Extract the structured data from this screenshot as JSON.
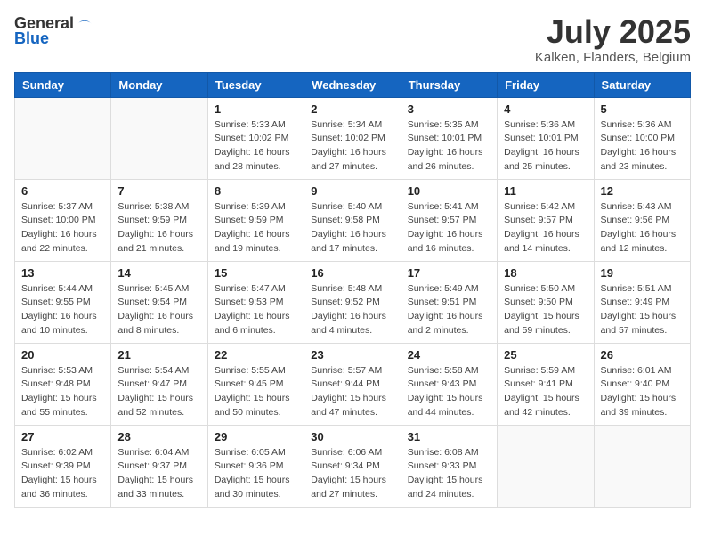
{
  "header": {
    "logo_general": "General",
    "logo_blue": "Blue",
    "month_year": "July 2025",
    "location": "Kalken, Flanders, Belgium"
  },
  "weekdays": [
    "Sunday",
    "Monday",
    "Tuesday",
    "Wednesday",
    "Thursday",
    "Friday",
    "Saturday"
  ],
  "weeks": [
    [
      {
        "day": "",
        "detail": ""
      },
      {
        "day": "",
        "detail": ""
      },
      {
        "day": "1",
        "detail": "Sunrise: 5:33 AM\nSunset: 10:02 PM\nDaylight: 16 hours\nand 28 minutes."
      },
      {
        "day": "2",
        "detail": "Sunrise: 5:34 AM\nSunset: 10:02 PM\nDaylight: 16 hours\nand 27 minutes."
      },
      {
        "day": "3",
        "detail": "Sunrise: 5:35 AM\nSunset: 10:01 PM\nDaylight: 16 hours\nand 26 minutes."
      },
      {
        "day": "4",
        "detail": "Sunrise: 5:36 AM\nSunset: 10:01 PM\nDaylight: 16 hours\nand 25 minutes."
      },
      {
        "day": "5",
        "detail": "Sunrise: 5:36 AM\nSunset: 10:00 PM\nDaylight: 16 hours\nand 23 minutes."
      }
    ],
    [
      {
        "day": "6",
        "detail": "Sunrise: 5:37 AM\nSunset: 10:00 PM\nDaylight: 16 hours\nand 22 minutes."
      },
      {
        "day": "7",
        "detail": "Sunrise: 5:38 AM\nSunset: 9:59 PM\nDaylight: 16 hours\nand 21 minutes."
      },
      {
        "day": "8",
        "detail": "Sunrise: 5:39 AM\nSunset: 9:59 PM\nDaylight: 16 hours\nand 19 minutes."
      },
      {
        "day": "9",
        "detail": "Sunrise: 5:40 AM\nSunset: 9:58 PM\nDaylight: 16 hours\nand 17 minutes."
      },
      {
        "day": "10",
        "detail": "Sunrise: 5:41 AM\nSunset: 9:57 PM\nDaylight: 16 hours\nand 16 minutes."
      },
      {
        "day": "11",
        "detail": "Sunrise: 5:42 AM\nSunset: 9:57 PM\nDaylight: 16 hours\nand 14 minutes."
      },
      {
        "day": "12",
        "detail": "Sunrise: 5:43 AM\nSunset: 9:56 PM\nDaylight: 16 hours\nand 12 minutes."
      }
    ],
    [
      {
        "day": "13",
        "detail": "Sunrise: 5:44 AM\nSunset: 9:55 PM\nDaylight: 16 hours\nand 10 minutes."
      },
      {
        "day": "14",
        "detail": "Sunrise: 5:45 AM\nSunset: 9:54 PM\nDaylight: 16 hours\nand 8 minutes."
      },
      {
        "day": "15",
        "detail": "Sunrise: 5:47 AM\nSunset: 9:53 PM\nDaylight: 16 hours\nand 6 minutes."
      },
      {
        "day": "16",
        "detail": "Sunrise: 5:48 AM\nSunset: 9:52 PM\nDaylight: 16 hours\nand 4 minutes."
      },
      {
        "day": "17",
        "detail": "Sunrise: 5:49 AM\nSunset: 9:51 PM\nDaylight: 16 hours\nand 2 minutes."
      },
      {
        "day": "18",
        "detail": "Sunrise: 5:50 AM\nSunset: 9:50 PM\nDaylight: 15 hours\nand 59 minutes."
      },
      {
        "day": "19",
        "detail": "Sunrise: 5:51 AM\nSunset: 9:49 PM\nDaylight: 15 hours\nand 57 minutes."
      }
    ],
    [
      {
        "day": "20",
        "detail": "Sunrise: 5:53 AM\nSunset: 9:48 PM\nDaylight: 15 hours\nand 55 minutes."
      },
      {
        "day": "21",
        "detail": "Sunrise: 5:54 AM\nSunset: 9:47 PM\nDaylight: 15 hours\nand 52 minutes."
      },
      {
        "day": "22",
        "detail": "Sunrise: 5:55 AM\nSunset: 9:45 PM\nDaylight: 15 hours\nand 50 minutes."
      },
      {
        "day": "23",
        "detail": "Sunrise: 5:57 AM\nSunset: 9:44 PM\nDaylight: 15 hours\nand 47 minutes."
      },
      {
        "day": "24",
        "detail": "Sunrise: 5:58 AM\nSunset: 9:43 PM\nDaylight: 15 hours\nand 44 minutes."
      },
      {
        "day": "25",
        "detail": "Sunrise: 5:59 AM\nSunset: 9:41 PM\nDaylight: 15 hours\nand 42 minutes."
      },
      {
        "day": "26",
        "detail": "Sunrise: 6:01 AM\nSunset: 9:40 PM\nDaylight: 15 hours\nand 39 minutes."
      }
    ],
    [
      {
        "day": "27",
        "detail": "Sunrise: 6:02 AM\nSunset: 9:39 PM\nDaylight: 15 hours\nand 36 minutes."
      },
      {
        "day": "28",
        "detail": "Sunrise: 6:04 AM\nSunset: 9:37 PM\nDaylight: 15 hours\nand 33 minutes."
      },
      {
        "day": "29",
        "detail": "Sunrise: 6:05 AM\nSunset: 9:36 PM\nDaylight: 15 hours\nand 30 minutes."
      },
      {
        "day": "30",
        "detail": "Sunrise: 6:06 AM\nSunset: 9:34 PM\nDaylight: 15 hours\nand 27 minutes."
      },
      {
        "day": "31",
        "detail": "Sunrise: 6:08 AM\nSunset: 9:33 PM\nDaylight: 15 hours\nand 24 minutes."
      },
      {
        "day": "",
        "detail": ""
      },
      {
        "day": "",
        "detail": ""
      }
    ]
  ]
}
